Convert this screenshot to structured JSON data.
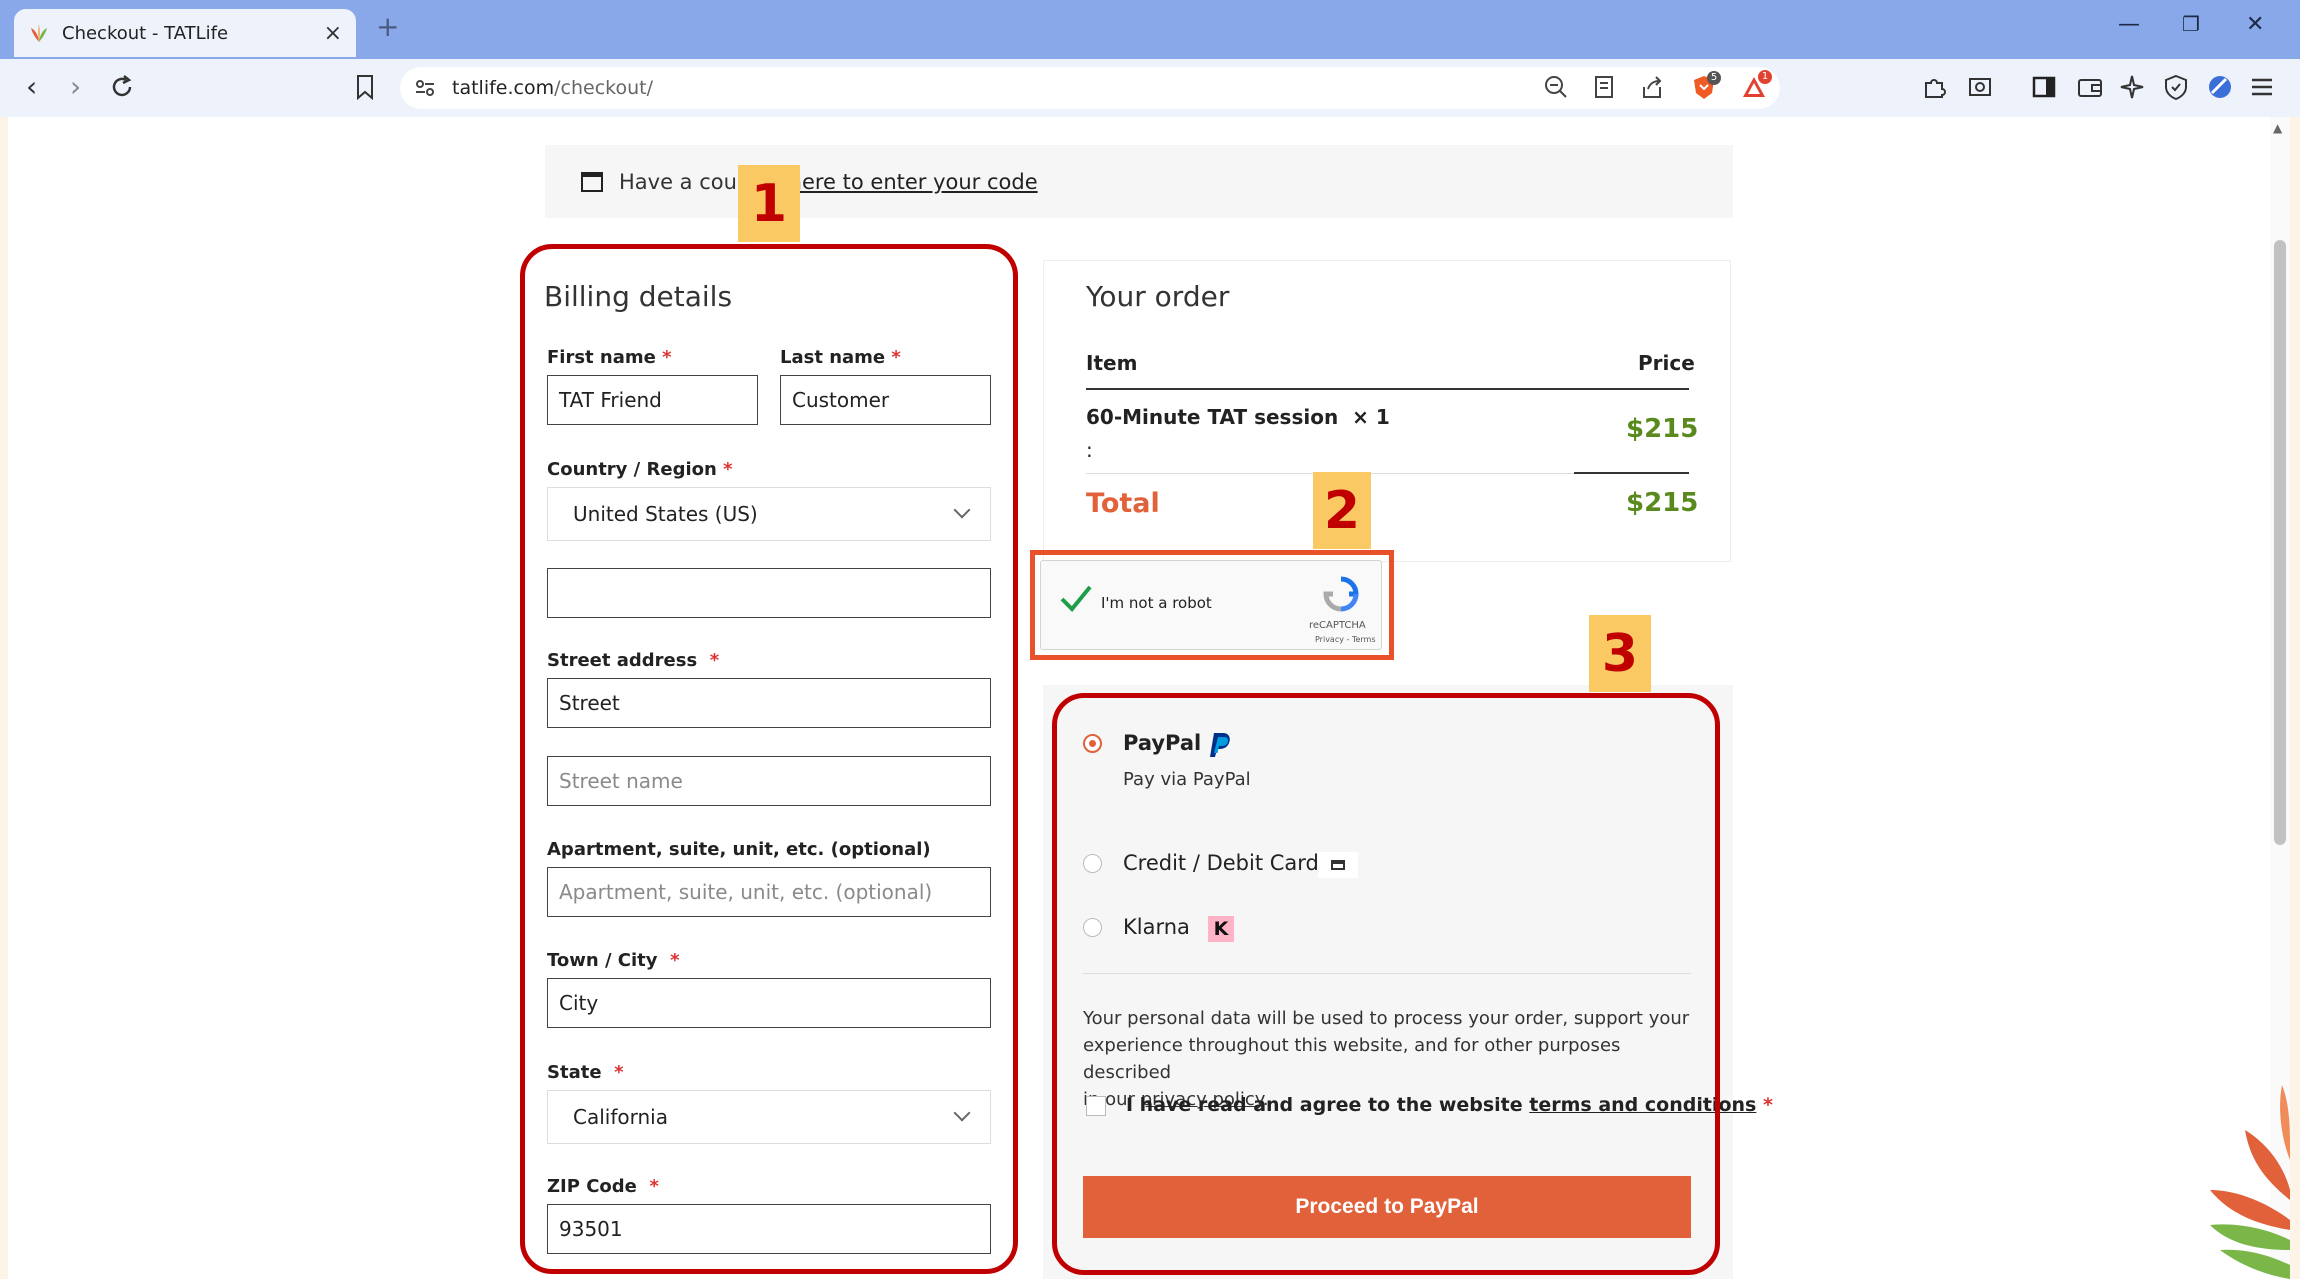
{
  "browser": {
    "tab_title": "Checkout - TATLife",
    "url_host": "tatlife.com",
    "url_path": "/checkout/",
    "shield_badge": "5",
    "alert_badge": "1"
  },
  "coupon": {
    "prefix": "Have a coup",
    "link": "ck here to enter your code"
  },
  "billing": {
    "title": "Billing details",
    "first_name_label": "First name",
    "first_name_value": "TAT Friend",
    "last_name_label": "Last name",
    "last_name_value": "Customer",
    "country_label": "Country / Region",
    "country_value": "United States (US)",
    "street_label": "Street address",
    "street_value": "Street",
    "street2_placeholder": "Street name",
    "apt_label": "Apartment, suite, unit, etc. (optional)",
    "apt_placeholder": "Apartment, suite, unit, etc. (optional)",
    "city_label": "Town / City",
    "city_value": "City",
    "state_label": "State",
    "state_value": "California",
    "zip_label": "ZIP Code",
    "zip_value": "93501",
    "required_mark": "*"
  },
  "order": {
    "title": "Your order",
    "col_item": "Item",
    "col_price": "Price",
    "item_name": "60-Minute TAT session",
    "item_qty": "× 1",
    "item_colon": ":",
    "item_price": "$215",
    "total_label": "Total",
    "total_value": "$215"
  },
  "recaptcha": {
    "label": "I'm not a robot",
    "brand": "reCAPTCHA",
    "links": "Privacy - Terms"
  },
  "payment": {
    "paypal_label": "PayPal",
    "paypal_desc": "Pay via PayPal",
    "card_label": "Credit / Debit Card",
    "klarna_label": "Klarna",
    "klarna_logo": "K",
    "privacy_text_1": "Your personal data will be used to process your order, support your",
    "privacy_text_2": "experience throughout this website, and for other purposes described",
    "privacy_text_3_prefix": "in our ",
    "privacy_link": "privacy policy",
    "privacy_text_3_suffix": ".",
    "terms_prefix": "I have read and agree to the website ",
    "terms_link": "terms and conditions",
    "terms_req": "*",
    "proceed_label": "Proceed to PayPal"
  },
  "annotations": {
    "badge_1": "1",
    "badge_2": "2",
    "badge_3": "3"
  },
  "colors": {
    "accent": "#e0613a",
    "price_green": "#5a8a1e",
    "annotation_red": "#c00000",
    "annotation_orange": "#e8512a",
    "badge_yellow": "#fbc964"
  }
}
